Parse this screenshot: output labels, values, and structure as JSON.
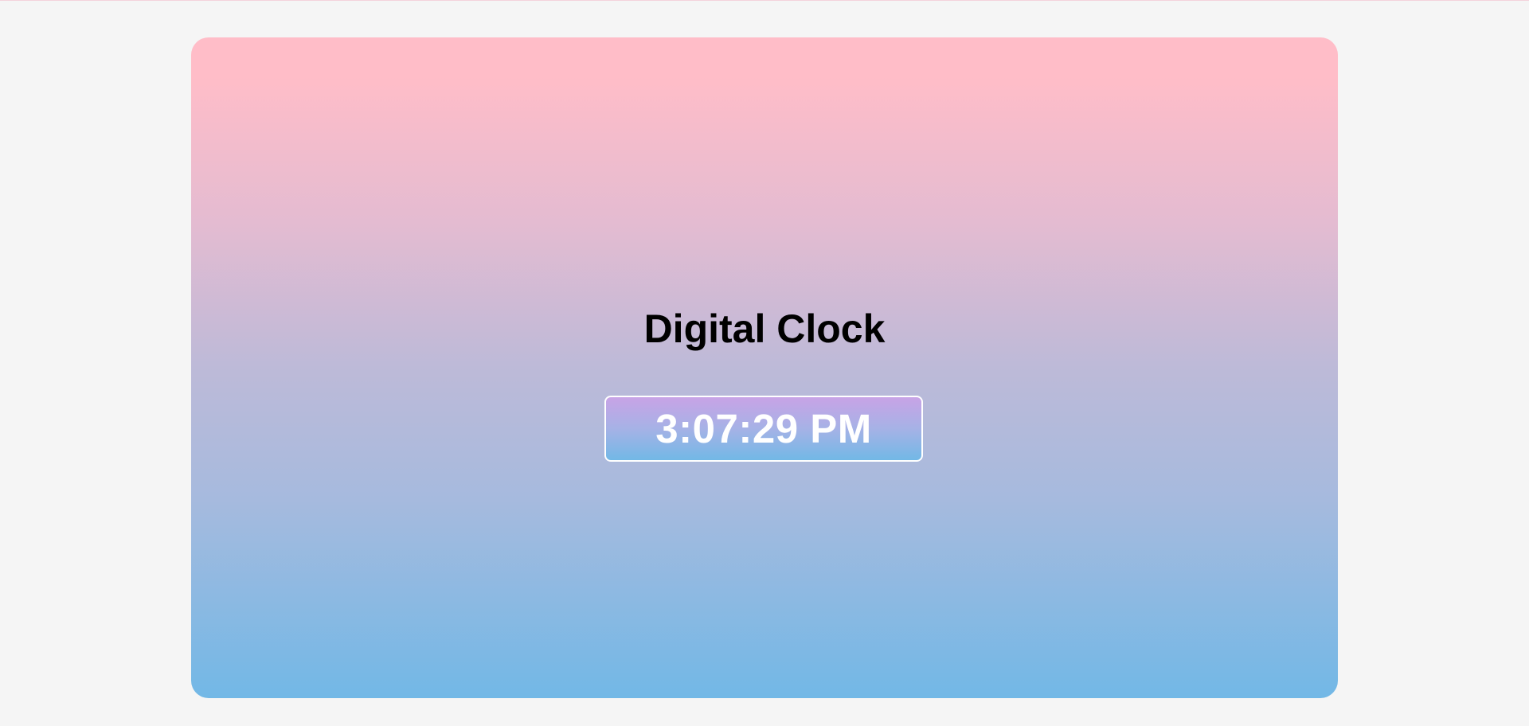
{
  "page": {
    "title": "Digital Clock"
  },
  "clock": {
    "time": "3:07:29 PM"
  },
  "colors": {
    "page_background": "#f5f5f5",
    "card_gradient_top": "#ffbdc8",
    "card_gradient_bottom": "#72b8e6",
    "clock_gradient_top": "#c8a3e6",
    "clock_gradient_bottom": "#72b8e6",
    "title_text": "#000000",
    "clock_text": "#ffffff"
  }
}
